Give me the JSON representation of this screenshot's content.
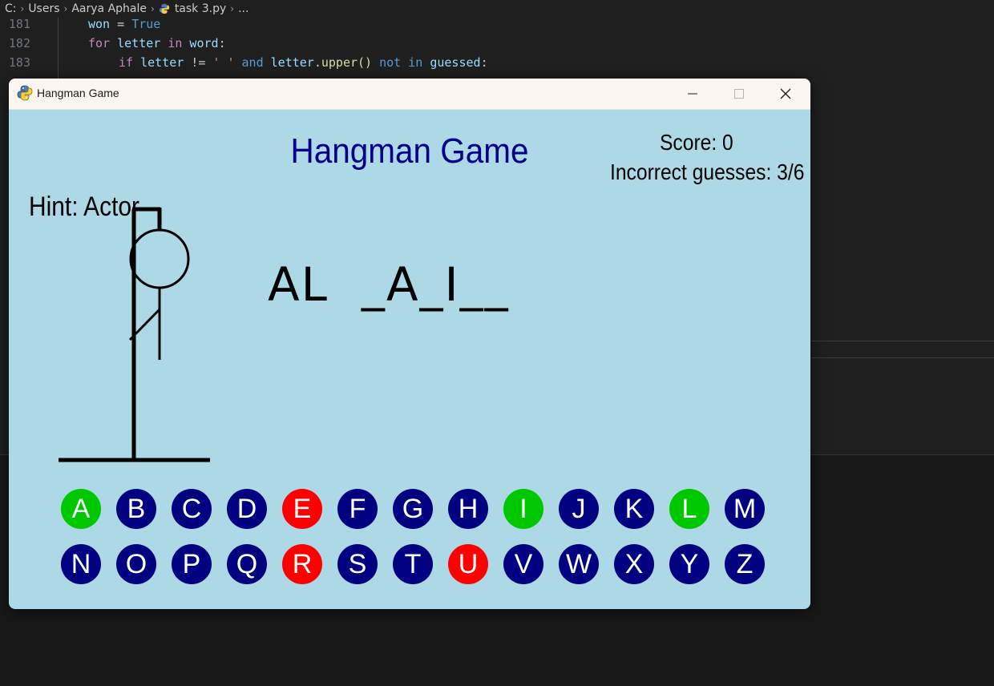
{
  "breadcrumb": [
    "C:",
    "Users",
    "Aarya Aphale",
    "task 3.py",
    "..."
  ],
  "code_lines": [
    {
      "num": "181"
    },
    {
      "num": "182"
    },
    {
      "num": "183"
    }
  ],
  "code_tokens": {
    "l181_won": "won",
    "l181_eq": " = ",
    "l181_true": "True",
    "l182_for": "for",
    "l182_letter": " letter ",
    "l182_in": "in",
    "l182_word": " word",
    "l182_colon": ":",
    "l183_if": "if",
    "l183_letter": " letter",
    "l183_neq": " != ",
    "l183_str": "' '",
    "l183_and": " and",
    "l183_letter2": " letter",
    "l183_dot": ".",
    "l183_upper": "upper",
    "l183_paren": "()",
    "l183_not": " not",
    "l183_in": " in",
    "l183_guessed": " guessed",
    "l183_colon": ":"
  },
  "window": {
    "title": "Hangman Game",
    "background": "#add8e6"
  },
  "game": {
    "title": "Hangman Game",
    "score": "Score: 0",
    "incorrect": "Incorrect guesses: 3/6",
    "hint": "Hint: Actor",
    "word_display": "AL  _A_I__"
  },
  "colors": {
    "default_letter": "#000080",
    "correct_letter": "#00c800",
    "wrong_letter": "#ff0000",
    "title_color": "#00008b"
  },
  "letters": [
    {
      "letter": "A",
      "state": "correct"
    },
    {
      "letter": "B",
      "state": "unused"
    },
    {
      "letter": "C",
      "state": "unused"
    },
    {
      "letter": "D",
      "state": "unused"
    },
    {
      "letter": "E",
      "state": "wrong"
    },
    {
      "letter": "F",
      "state": "unused"
    },
    {
      "letter": "G",
      "state": "unused"
    },
    {
      "letter": "H",
      "state": "unused"
    },
    {
      "letter": "I",
      "state": "correct"
    },
    {
      "letter": "J",
      "state": "unused"
    },
    {
      "letter": "K",
      "state": "unused"
    },
    {
      "letter": "L",
      "state": "correct"
    },
    {
      "letter": "M",
      "state": "unused"
    },
    {
      "letter": "N",
      "state": "unused"
    },
    {
      "letter": "O",
      "state": "unused"
    },
    {
      "letter": "P",
      "state": "unused"
    },
    {
      "letter": "Q",
      "state": "unused"
    },
    {
      "letter": "R",
      "state": "wrong"
    },
    {
      "letter": "S",
      "state": "unused"
    },
    {
      "letter": "T",
      "state": "unused"
    },
    {
      "letter": "U",
      "state": "wrong"
    },
    {
      "letter": "V",
      "state": "unused"
    },
    {
      "letter": "W",
      "state": "unused"
    },
    {
      "letter": "X",
      "state": "unused"
    },
    {
      "letter": "Y",
      "state": "unused"
    },
    {
      "letter": "Z",
      "state": "unused"
    }
  ]
}
